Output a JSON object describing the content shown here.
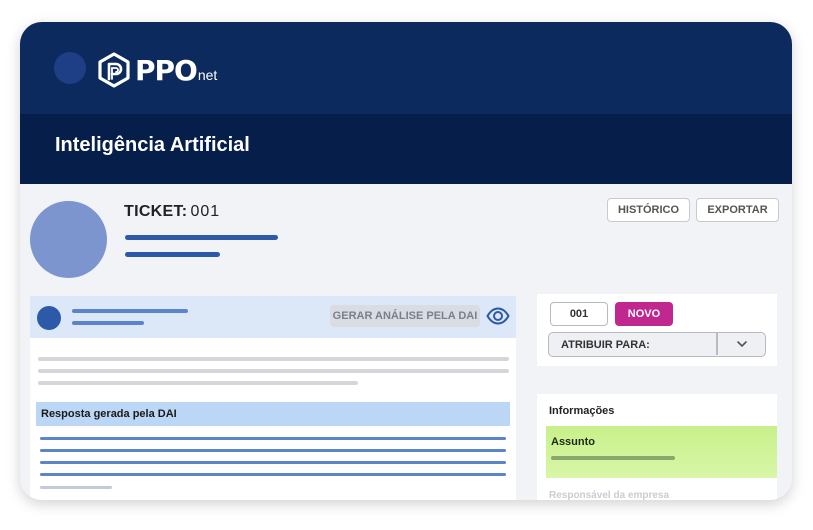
{
  "app": {
    "brand": "PPO",
    "brand_suffix": "net",
    "section_title": "Inteligência Artificial"
  },
  "ticket": {
    "label": "TICKET:",
    "number": "001"
  },
  "actions": {
    "history_label": "HISTÓRICO",
    "export_label": "EXPORTAR"
  },
  "analysis": {
    "generate_label": "GERAR ANÁLISE PELA DAI",
    "response_title": "Resposta gerada pela DAI"
  },
  "status": {
    "id": "001",
    "badge": "NOVO",
    "badge_color": "#c0278f",
    "assign_label": "ATRIBUIR PARA:"
  },
  "info": {
    "title": "Informações",
    "subject_label": "Assunto",
    "company_responsible_label": "Responsável da empresa"
  },
  "colors": {
    "header": "#0d2a5e",
    "title_bar": "#061e4a",
    "accent_blue": "#2d5aa8",
    "subject_highlight": "#c8f08a"
  }
}
